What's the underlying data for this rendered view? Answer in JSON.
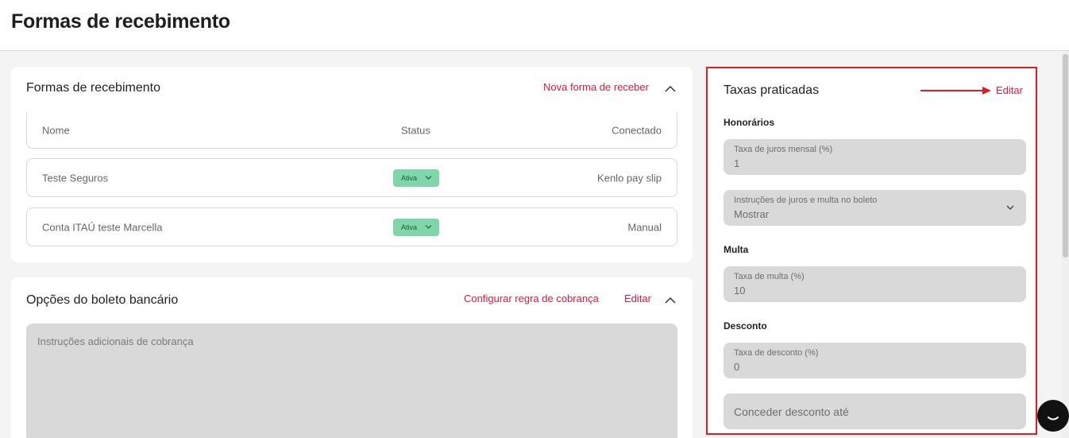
{
  "header": {
    "title": "Formas de recebimento"
  },
  "payment_methods": {
    "title": "Formas de recebimento",
    "new_link": "Nova forma de receber",
    "columns": [
      "Nome",
      "Status",
      "Conectado"
    ],
    "rows": [
      {
        "name": "Teste Seguros",
        "status": "Ativa",
        "connected": "Kenlo pay slip"
      },
      {
        "name": "Conta ITAÚ teste Marcella",
        "status": "Ativa",
        "connected": "Manual"
      }
    ]
  },
  "boleto_options": {
    "title": "Opções do boleto bancário",
    "configure_link": "Configurar regra de cobrança",
    "edit_link": "Editar",
    "instructions_placeholder": "Instruções adicionais de cobrança"
  },
  "rates": {
    "title": "Taxas praticadas",
    "edit_link": "Editar",
    "honorarios_label": "Honorários",
    "monthly_interest": {
      "label": "Taxa de juros mensal (%)",
      "value": "1"
    },
    "boleto_instructions": {
      "label": "Instruções de juros e multa no boleto",
      "value": "Mostrar"
    },
    "multa_label": "Multa",
    "fine_rate": {
      "label": "Taxa de multa (%)",
      "value": "10"
    },
    "desconto_label": "Desconto",
    "discount_rate": {
      "label": "Taxa de desconto (%)",
      "value": "0"
    },
    "discount_until": {
      "placeholder": "Conceder desconto até"
    }
  },
  "colors": {
    "accent": "#e3173e",
    "badge": "#7fd6a8",
    "highlight_border": "#e31b23"
  },
  "icons": [
    "chevron-up-icon",
    "chevron-down-icon",
    "arrow-right-icon",
    "chat-icon"
  ]
}
